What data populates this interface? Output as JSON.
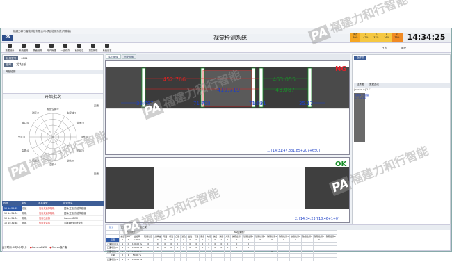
{
  "window": {
    "title": "福建力和行智能科技有限公司-项目检测系统(开发版)",
    "logo": "PA"
  },
  "header": {
    "system_title": "视觉检测系统",
    "clock": "14:34:25",
    "stats": [
      {
        "label": "内存",
        "value": "89%",
        "color": "#f5a623"
      },
      {
        "label": "C",
        "value": "42%",
        "color": "#f5c842"
      },
      {
        "label": "D",
        "value": "37%",
        "color": "#f5c842"
      },
      {
        "label": "E",
        "value": "16%",
        "color": "#f5c842"
      },
      {
        "label": "F",
        "value": "76%",
        "color": "#f08a24"
      }
    ]
  },
  "toolbar": {
    "buttons": [
      "数据统计",
      "系统配置",
      "界面设置",
      "用户管理",
      "一键保存",
      "检测信息",
      "报表管理",
      "系统日志"
    ],
    "right_label": "日志",
    "user_label": "用户"
  },
  "left_panel": {
    "model_label": "检测型号",
    "model_value": "0001",
    "code_label": "型号",
    "code_value": "分切前",
    "tab_label": "开始检测",
    "start_batch": "开始批次",
    "radar": {
      "axes": [
        "轮廓测量",
        "外观",
        "缺陷检测",
        "颜色检测",
        "尺寸检测",
        "焊缝检测",
        "涂胶检测",
        "字符检测",
        "定位检测",
        "极耳检测",
        "视觉定位",
        "其它"
      ],
      "labels": [
        "轮毂位置:0",
        "支撑轴:0",
        "背面:0",
        "标签:0",
        "凸起:0",
        "划伤:0",
        "溢胶:0",
        "气泡:0",
        "杂质:0",
        "夹点:0",
        "缺口:0",
        "涂层:0"
      ],
      "corner_label": "正面",
      "bottom_label": "反面"
    }
  },
  "log": {
    "columns": [
      "时间",
      "类型",
      "消息类型",
      "错误信息"
    ],
    "rows": [
      {
        "time": "10 14:22:22",
        "type": "系统",
        "msg": "信息未选择相机",
        "err": "图像(正面)的结构错误"
      },
      {
        "time": "10 14:31:34",
        "type": "相机",
        "msg": "信息未选择相机",
        "err": "图像(正面)的结构错误"
      },
      {
        "time": "10 14:31:34",
        "type": "相机",
        "msg": "信息已连接",
        "err": "CameraDW2"
      },
      {
        "time": "10 14:31:48",
        "type": "相机",
        "msg": "信息未选择",
        "err": "未找到配置/默认值"
      }
    ]
  },
  "status_bar": {
    "elapsed": "运行时间: 0天0小时2分",
    "camera1": "CameraDW2",
    "camera2": "Omron客户端"
  },
  "center": {
    "tabs": [
      "实时图像",
      "历史图像"
    ],
    "image1": {
      "result": "NG",
      "result_color": "#e0202a",
      "measure_top": "452.766",
      "measure_mid": "419.719",
      "measure_right_top": "463.055",
      "measure_right_mid": "43.087",
      "left_small": "35.787",
      "center_small": "71.700",
      "right_small": "71.031",
      "far_small": "35.17",
      "timestamp": "1. [14:31:47.831.85+207+650]"
    },
    "image2": {
      "result": "OK",
      "result_color": "#1a8f2a",
      "timestamp": "2. [14:34:23.718.46+1+0]"
    }
  },
  "right_panel": {
    "tab": "全屏幕",
    "sub_tabs": [
      "结果图",
      "数据曲线"
    ],
    "nav": "1 / 1",
    "note_line1": "相机1已连接",
    "note_line2": "14:34:18"
  },
  "bottom": {
    "tabs": [
      "统计",
      "正面记录",
      "反面记录"
    ],
    "group1": "检测统计",
    "group2": "NG结果统计",
    "columns": [
      "",
      "总数",
      "NG",
      "合格率",
      "轮毂位置",
      "支撑轴",
      "背面",
      "标签",
      "凸起",
      "划伤",
      "溢胶",
      "气泡",
      "杂质",
      "夹点",
      "缺口",
      "涂层",
      "外观",
      "缺陷检测1",
      "缺陷检测2",
      "缺陷检测3",
      "缺陷检测4",
      "缺陷检测5",
      "缺陷检测6",
      "缺陷检测7",
      "缺陷检测8",
      "缺陷检测9"
    ],
    "rows": [
      [
        "正面",
        "1",
        "1",
        "0.00 %",
        "0",
        "0",
        "0",
        "0",
        "0",
        "0",
        "0",
        "0",
        "0",
        "0",
        "0",
        "1",
        "1",
        "0",
        "0",
        "0",
        "0",
        "0",
        "1",
        "1",
        "0",
        ""
      ],
      [
        "正面切割(1)",
        "1",
        "0",
        "100.00 %",
        "0",
        "0",
        "0",
        "0",
        "0",
        "0",
        "0",
        "0",
        "0",
        "0",
        "0",
        "0",
        "0",
        "0",
        "0",
        "",
        "",
        "",
        "",
        "",
        "",
        ""
      ],
      [
        "正面切割(2)",
        "1",
        "0",
        "100.00 %",
        "0",
        "0",
        "0",
        "0",
        "0",
        "0",
        "0",
        "0",
        "0",
        "0",
        "0",
        "0",
        "0",
        "0",
        "0",
        "",
        "",
        "",
        "",
        "",
        "",
        ""
      ],
      [
        "正面切割(3)",
        "1",
        "0",
        "100.00 %",
        "",
        "",
        "",
        "",
        "",
        "",
        "",
        "",
        "",
        "",
        "",
        "",
        "",
        "",
        "",
        "",
        "0",
        "",
        "",
        "",
        "",
        ""
      ],
      [
        "反面",
        "2",
        "1",
        "50.00 %",
        "",
        "",
        "",
        "",
        "",
        "",
        "",
        "",
        "",
        "",
        "",
        "",
        "",
        "",
        "",
        "",
        "",
        "",
        "",
        "",
        "",
        ""
      ],
      [
        "反面切割(1)",
        "1",
        "0",
        "100.00 %",
        "",
        "",
        "",
        "",
        "",
        "",
        "",
        "",
        "",
        "",
        "",
        "",
        "",
        "",
        "",
        "",
        "",
        "",
        "",
        "",
        "",
        ""
      ]
    ]
  },
  "watermark": {
    "badge": "PA",
    "text": "福建力和行智能"
  }
}
